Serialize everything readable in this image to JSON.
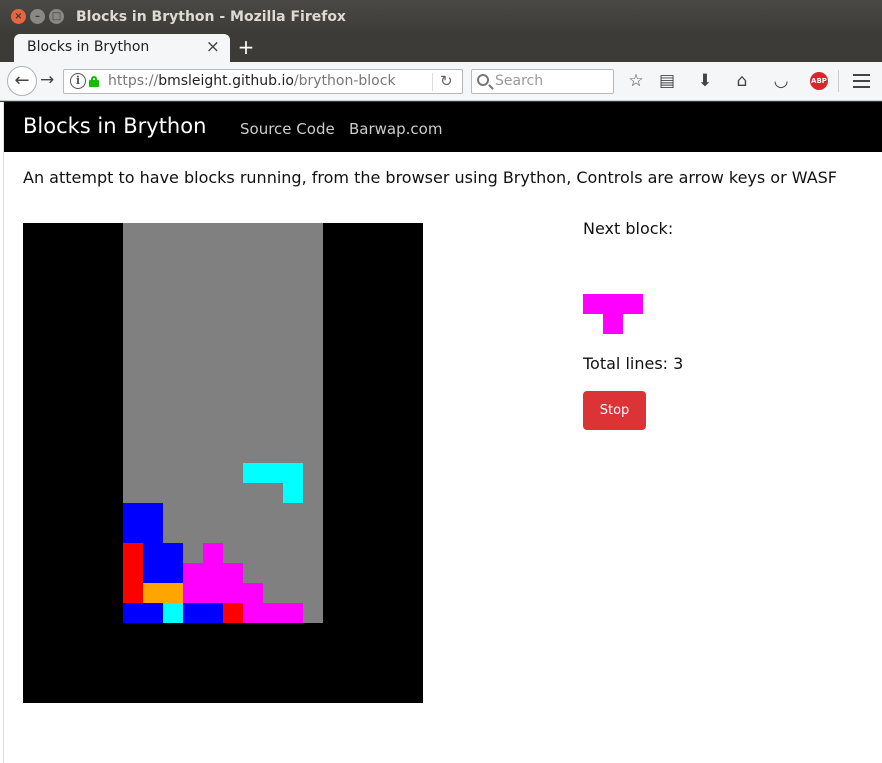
{
  "window": {
    "title": "Blocks in Brython - Mozilla Firefox"
  },
  "tab": {
    "label": "Blocks in Brython",
    "close": "×",
    "new_tab": "+"
  },
  "navbar": {
    "url_prefix": "https://",
    "url_host": "bmsleight.github.io",
    "url_path": "/brython-block",
    "search_placeholder": "Search",
    "abp_label": "ABP"
  },
  "site": {
    "brand": "Blocks in Brython",
    "nav_links": [
      "Source Code",
      "Barwap.com"
    ],
    "intro": "An attempt to have blocks running, from the browser using Brython, Controls are arrow keys or WASF"
  },
  "game": {
    "next_label": "Next block:",
    "lines_label": "Total lines: 3",
    "stop_label": "Stop",
    "colors": {
      "board": "#000000",
      "well": "#808080",
      "cyan": "#00ffff",
      "blue": "#0000ff",
      "red": "#ff0000",
      "magenta": "#ff00ff",
      "orange": "#ffa500"
    },
    "well_size": {
      "cols": 10,
      "rows": 20
    },
    "falling_piece": {
      "color": "cyan",
      "cells": [
        [
          6,
          12
        ],
        [
          7,
          12
        ],
        [
          8,
          12
        ],
        [
          8,
          13
        ]
      ]
    },
    "settled_cells": [
      [
        0,
        14,
        "blue"
      ],
      [
        1,
        14,
        "blue"
      ],
      [
        0,
        15,
        "blue"
      ],
      [
        1,
        15,
        "blue"
      ],
      [
        0,
        16,
        "red"
      ],
      [
        1,
        16,
        "blue"
      ],
      [
        2,
        16,
        "blue"
      ],
      [
        4,
        16,
        "magenta"
      ],
      [
        0,
        17,
        "red"
      ],
      [
        1,
        17,
        "blue"
      ],
      [
        2,
        17,
        "blue"
      ],
      [
        3,
        17,
        "magenta"
      ],
      [
        4,
        17,
        "magenta"
      ],
      [
        5,
        17,
        "magenta"
      ],
      [
        0,
        18,
        "red"
      ],
      [
        1,
        18,
        "orange"
      ],
      [
        2,
        18,
        "orange"
      ],
      [
        3,
        18,
        "magenta"
      ],
      [
        4,
        18,
        "magenta"
      ],
      [
        5,
        18,
        "magenta"
      ],
      [
        6,
        18,
        "magenta"
      ],
      [
        0,
        19,
        "blue"
      ],
      [
        1,
        19,
        "blue"
      ],
      [
        2,
        19,
        "cyan"
      ],
      [
        3,
        19,
        "blue"
      ],
      [
        4,
        19,
        "blue"
      ],
      [
        5,
        19,
        "red"
      ],
      [
        6,
        19,
        "magenta"
      ],
      [
        7,
        19,
        "magenta"
      ],
      [
        8,
        19,
        "magenta"
      ]
    ],
    "next_piece": {
      "color": "magenta",
      "cells": [
        [
          0,
          0
        ],
        [
          1,
          0
        ],
        [
          2,
          0
        ],
        [
          1,
          1
        ]
      ]
    }
  }
}
